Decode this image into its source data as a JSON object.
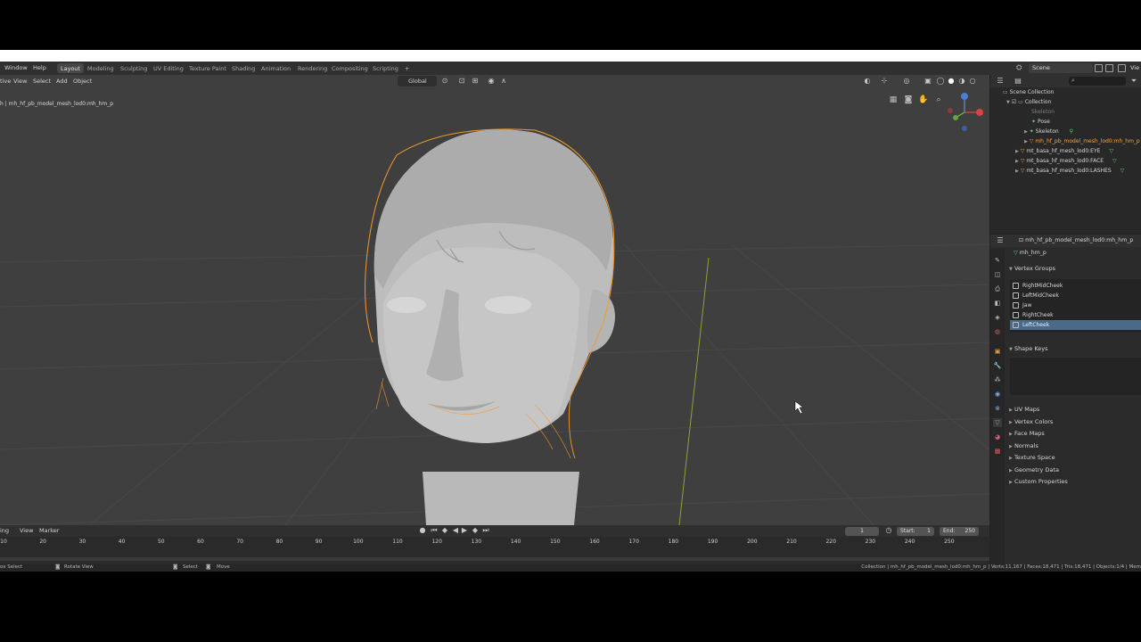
{
  "topbar": {
    "menus": [
      "Window",
      "Help"
    ],
    "workspaces": [
      {
        "label": "Layout",
        "active": true
      },
      {
        "label": "Modeling",
        "active": false
      },
      {
        "label": "Sculpting",
        "active": false
      },
      {
        "label": "UV Editing",
        "active": false
      },
      {
        "label": "Texture Paint",
        "active": false
      },
      {
        "label": "Shading",
        "active": false
      },
      {
        "label": "Animation",
        "active": false
      },
      {
        "label": "Rendering",
        "active": false
      },
      {
        "label": "Compositing",
        "active": false
      },
      {
        "label": "Scripting",
        "active": false
      }
    ],
    "add_tab": "+",
    "scene_label": "Scene",
    "view_layer_label": "Vie"
  },
  "viewport": {
    "menus": [
      "View",
      "Select",
      "Add",
      "Object"
    ],
    "left_label": "tive",
    "orientation": "Global",
    "overlay_line1": "",
    "overlay_line2": "h | mh_hf_pb_model_mesh_lod0:mh_hm_p"
  },
  "timeline": {
    "menus": [
      "ing",
      "View",
      "Marker"
    ],
    "current_frame": "1",
    "start_label": "Start:",
    "start_value": "1",
    "end_label": "End:",
    "end_value": "250",
    "ticks": [
      "10",
      "20",
      "30",
      "40",
      "50",
      "60",
      "70",
      "80",
      "90",
      "100",
      "110",
      "120",
      "130",
      "140",
      "150",
      "160",
      "170",
      "180",
      "190",
      "200",
      "210",
      "220",
      "230",
      "240",
      "250"
    ]
  },
  "statusbar": {
    "left": [
      "ox Select",
      "Rotate View",
      "Select",
      "Move"
    ],
    "right": "Collection | mh_hf_pb_model_mesh_lod0:mh_hm_p | Verts:11,167 | Faces:18,471 | Tris:18,471 | Objects:1/4 | Mem"
  },
  "outliner": {
    "scene_collection": "Scene Collection",
    "collection": "Collection",
    "skeleton_dim": "Skeleton",
    "pose": "Pose",
    "skeleton": "Skeleton",
    "selected_mesh": "mh_hf_pb_model_mesh_lod0:mh_hm_p",
    "eye": "mt_basa_hf_mesh_lod0:EYE",
    "face": "mt_basa_hf_mesh_lod0:FACE",
    "lashes": "mt_basa_hf_mesh_lod0:LASHES"
  },
  "properties": {
    "object_name": "mh_hf_pb_model_mesh_lod0:mh_hm_p",
    "mesh_name": "mh_hm_p",
    "vertex_groups_title": "Vertex Groups",
    "vertex_groups": [
      "RightMidCheek",
      "LeftMidCheek",
      "Jaw",
      "RightCheek",
      "LeftCheek"
    ],
    "active_vertex_group": 4,
    "shape_keys_title": "Shape Keys",
    "panels": [
      "UV Maps",
      "Vertex Colors",
      "Face Maps",
      "Normals",
      "Texture Space",
      "Geometry Data",
      "Custom Properties"
    ]
  },
  "colors": {
    "selection_outline": "#f59a2a",
    "active_row": "#4a6a8a",
    "viewport_bg": "#3f3f3f"
  }
}
